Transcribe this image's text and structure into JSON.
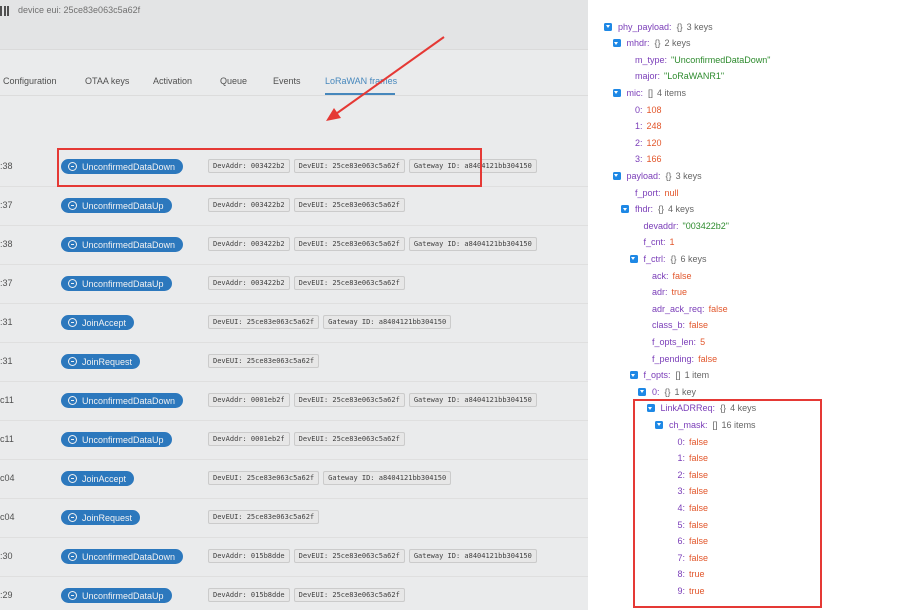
{
  "header": {
    "device_eui_label": "device eui: 25ce83e063c5a62f"
  },
  "tabs": [
    {
      "label": "Configuration"
    },
    {
      "label": "OTAA keys"
    },
    {
      "label": "Activation"
    },
    {
      "label": "Queue"
    },
    {
      "label": "Events"
    },
    {
      "label": "LoRaWAN frames"
    }
  ],
  "active_tab": "LoRaWAN frames",
  "frames": [
    {
      "time": ":38",
      "type": "UnconfirmedDataDown",
      "tags": [
        "DevAddr: 003422b2",
        "DevEUI: 25ce83e063c5a62f",
        "Gateway ID: a8404121bb304150"
      ]
    },
    {
      "time": ":37",
      "type": "UnconfirmedDataUp",
      "tags": [
        "DevAddr: 003422b2",
        "DevEUI: 25ce83e063c5a62f"
      ]
    },
    {
      "time": ":38",
      "type": "UnconfirmedDataDown",
      "tags": [
        "DevAddr: 003422b2",
        "DevEUI: 25ce83e063c5a62f",
        "Gateway ID: a8404121bb304150"
      ]
    },
    {
      "time": ":37",
      "type": "UnconfirmedDataUp",
      "tags": [
        "DevAddr: 003422b2",
        "DevEUI: 25ce83e063c5a62f"
      ]
    },
    {
      "time": ":31",
      "type": "JoinAccept",
      "tags": [
        "DevEUI: 25ce83e063c5a62f",
        "Gateway ID: a8404121bb304150"
      ]
    },
    {
      "time": ":31",
      "type": "JoinRequest",
      "tags": [
        "DevEUI: 25ce83e063c5a62f"
      ]
    },
    {
      "time": "c11",
      "type": "UnconfirmedDataDown",
      "tags": [
        "DevAddr: 0001eb2f",
        "DevEUI: 25ce83e063c5a62f",
        "Gateway ID: a8404121bb304150"
      ]
    },
    {
      "time": "c11",
      "type": "UnconfirmedDataUp",
      "tags": [
        "DevAddr: 0001eb2f",
        "DevEUI: 25ce83e063c5a62f"
      ]
    },
    {
      "time": "c04",
      "type": "JoinAccept",
      "tags": [
        "DevEUI: 25ce83e063c5a62f",
        "Gateway ID: a8404121bb304150"
      ]
    },
    {
      "time": "c04",
      "type": "JoinRequest",
      "tags": [
        "DevEUI: 25ce83e063c5a62f"
      ]
    },
    {
      "time": ":30",
      "type": "UnconfirmedDataDown",
      "tags": [
        "DevAddr: 015b8dde",
        "DevEUI: 25ce83e063c5a62f",
        "Gateway ID: a8404121bb304150"
      ]
    },
    {
      "time": ":29",
      "type": "UnconfirmedDataUp",
      "tags": [
        "DevAddr: 015b8dde",
        "DevEUI: 25ce83e063c5a62f"
      ]
    }
  ],
  "json_tree": [
    {
      "depth": 0,
      "key": "phy_payload",
      "kind": "object",
      "count": "3 keys"
    },
    {
      "depth": 1,
      "key": "mhdr",
      "kind": "object",
      "count": "2 keys"
    },
    {
      "depth": 2,
      "key": "m_type",
      "kind": "string",
      "value": "\"UnconfirmedDataDown\""
    },
    {
      "depth": 2,
      "key": "major",
      "kind": "string",
      "value": "\"LoRaWANR1\""
    },
    {
      "depth": 1,
      "key": "mic",
      "kind": "array",
      "count": "4 items"
    },
    {
      "depth": 2,
      "key": "0",
      "kind": "number",
      "value": "108"
    },
    {
      "depth": 2,
      "key": "1",
      "kind": "number",
      "value": "248"
    },
    {
      "depth": 2,
      "key": "2",
      "kind": "number",
      "value": "120"
    },
    {
      "depth": 2,
      "key": "3",
      "kind": "number",
      "value": "166"
    },
    {
      "depth": 1,
      "key": "payload",
      "kind": "object",
      "count": "3 keys"
    },
    {
      "depth": 2,
      "key": "f_port",
      "kind": "null",
      "value": "null"
    },
    {
      "depth": 2,
      "key": "fhdr",
      "kind": "object",
      "count": "4 keys"
    },
    {
      "depth": 3,
      "key": "devaddr",
      "kind": "string",
      "value": "\"003422b2\""
    },
    {
      "depth": 3,
      "key": "f_cnt",
      "kind": "number",
      "value": "1"
    },
    {
      "depth": 3,
      "key": "f_ctrl",
      "kind": "object",
      "count": "6 keys"
    },
    {
      "depth": 4,
      "key": "ack",
      "kind": "bool",
      "value": "false"
    },
    {
      "depth": 4,
      "key": "adr",
      "kind": "bool",
      "value": "true"
    },
    {
      "depth": 4,
      "key": "adr_ack_req",
      "kind": "bool",
      "value": "false"
    },
    {
      "depth": 4,
      "key": "class_b",
      "kind": "bool",
      "value": "false"
    },
    {
      "depth": 4,
      "key": "f_opts_len",
      "kind": "number",
      "value": "5"
    },
    {
      "depth": 4,
      "key": "f_pending",
      "kind": "bool",
      "value": "false"
    },
    {
      "depth": 3,
      "key": "f_opts",
      "kind": "array",
      "count": "1 item"
    },
    {
      "depth": 4,
      "key": "0",
      "kind": "object",
      "count": "1 key"
    },
    {
      "depth": 5,
      "key": "LinkADRReq",
      "kind": "object",
      "count": "4 keys"
    },
    {
      "depth": 6,
      "key": "ch_mask",
      "kind": "array",
      "count": "16 items"
    },
    {
      "depth": 7,
      "key": "0",
      "kind": "bool",
      "value": "false"
    },
    {
      "depth": 7,
      "key": "1",
      "kind": "bool",
      "value": "false"
    },
    {
      "depth": 7,
      "key": "2",
      "kind": "bool",
      "value": "false"
    },
    {
      "depth": 7,
      "key": "3",
      "kind": "bool",
      "value": "false"
    },
    {
      "depth": 7,
      "key": "4",
      "kind": "bool",
      "value": "false"
    },
    {
      "depth": 7,
      "key": "5",
      "kind": "bool",
      "value": "false"
    },
    {
      "depth": 7,
      "key": "6",
      "kind": "bool",
      "value": "false"
    },
    {
      "depth": 7,
      "key": "7",
      "kind": "bool",
      "value": "false"
    },
    {
      "depth": 7,
      "key": "8",
      "kind": "bool",
      "value": "true"
    },
    {
      "depth": 7,
      "key": "9",
      "kind": "bool",
      "value": "true"
    }
  ],
  "colors": {
    "pill_blue": "#2f7fc8",
    "annotation_red": "#e53935",
    "json_key": "#7a3db8",
    "json_string": "#2e8b2e",
    "json_literal": "#e2572c",
    "caret_blue": "#1e88e5"
  }
}
